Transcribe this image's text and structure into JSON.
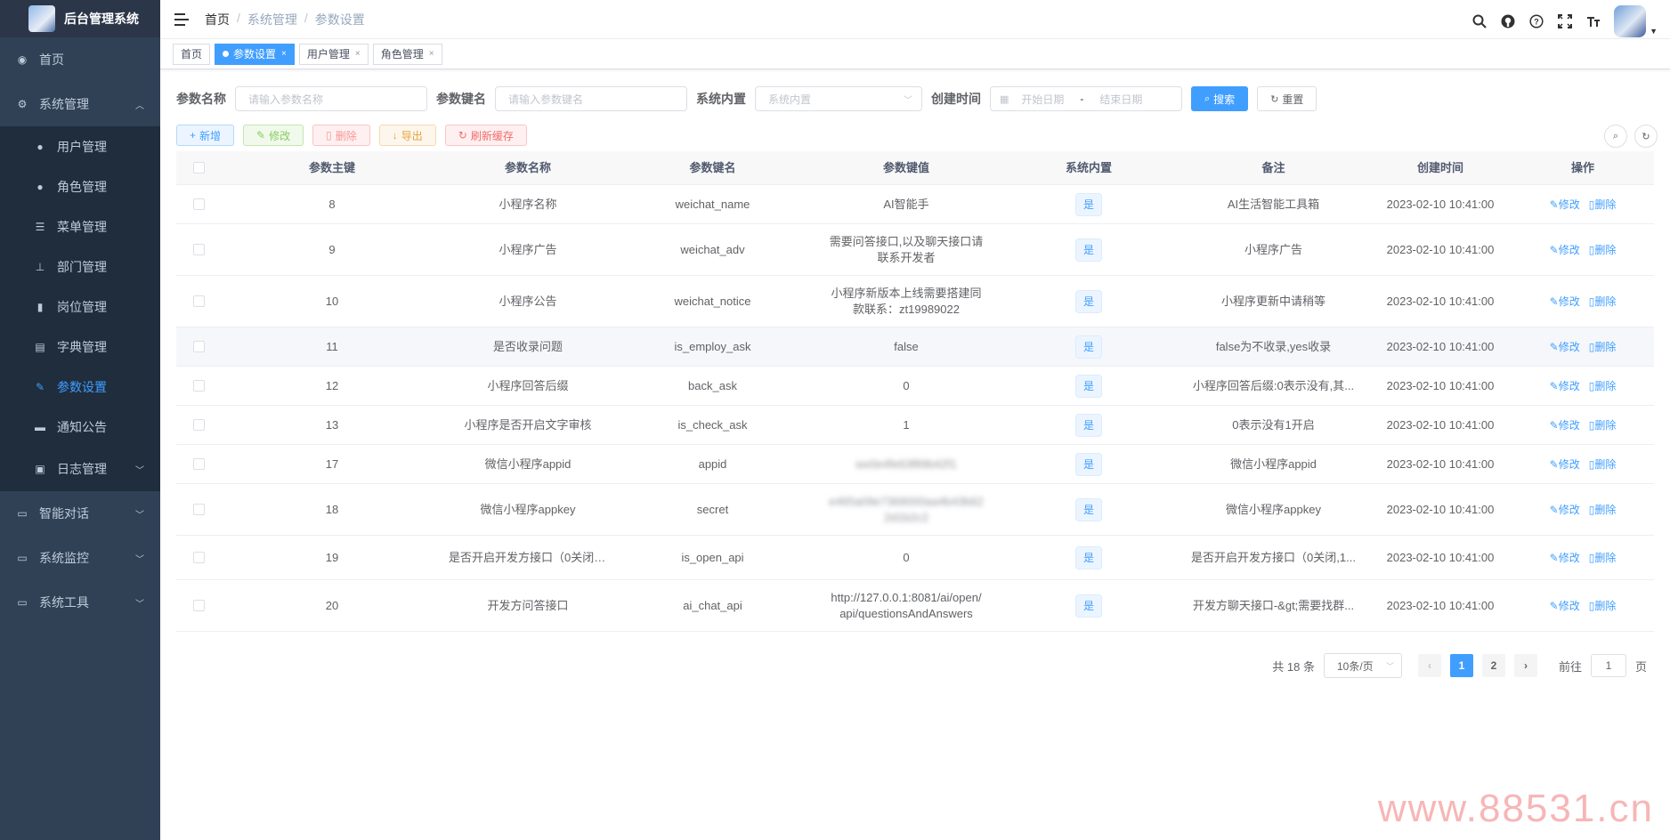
{
  "sidebar": {
    "title": "后台管理系统",
    "items": [
      {
        "label": "首页",
        "icon": "dashboard-icon"
      },
      {
        "label": "系统管理",
        "icon": "gear-icon",
        "expanded": true
      },
      {
        "label": "智能对话",
        "icon": "chat-icon"
      },
      {
        "label": "系统监控",
        "icon": "monitor-icon"
      },
      {
        "label": "系统工具",
        "icon": "toolbox-icon"
      }
    ],
    "sub_items": [
      {
        "label": "用户管理",
        "icon": "user-icon"
      },
      {
        "label": "角色管理",
        "icon": "people-icon"
      },
      {
        "label": "菜单管理",
        "icon": "tree-table-icon"
      },
      {
        "label": "部门管理",
        "icon": "org-tree-icon"
      },
      {
        "label": "岗位管理",
        "icon": "post-icon"
      },
      {
        "label": "字典管理",
        "icon": "dict-icon"
      },
      {
        "label": "参数设置",
        "icon": "edit-icon",
        "active": true
      },
      {
        "label": "通知公告",
        "icon": "message-icon"
      },
      {
        "label": "日志管理",
        "icon": "log-icon"
      }
    ]
  },
  "breadcrumb": [
    "首页",
    "系统管理",
    "参数设置"
  ],
  "tags": [
    {
      "label": "首页"
    },
    {
      "label": "参数设置",
      "active": true
    },
    {
      "label": "用户管理"
    },
    {
      "label": "角色管理"
    }
  ],
  "search": {
    "name_label": "参数名称",
    "name_placeholder": "请输入参数名称",
    "key_label": "参数键名",
    "key_placeholder": "请输入参数键名",
    "type_label": "系统内置",
    "type_placeholder": "系统内置",
    "time_label": "创建时间",
    "start_placeholder": "开始日期",
    "range_sep": "-",
    "end_placeholder": "结束日期",
    "search_btn": "搜索",
    "reset_btn": "重置"
  },
  "actions": {
    "add": "新增",
    "edit": "修改",
    "delete": "删除",
    "export": "导出",
    "refresh": "刷新缓存"
  },
  "table": {
    "headers": [
      "参数主键",
      "参数名称",
      "参数键名",
      "参数键值",
      "系统内置",
      "备注",
      "创建时间",
      "操作"
    ],
    "op_edit": "修改",
    "op_delete": "删除",
    "rows": [
      {
        "id": "8",
        "name": "小程序名称",
        "key": "weichat_name",
        "value": "AI智能手",
        "builtin": "是",
        "remark": "AI生活智能工具箱",
        "time": "2023-02-10 10:41:00"
      },
      {
        "id": "9",
        "name": "小程序广告",
        "key": "weichat_adv",
        "value": "需要问答接口,以及聊天接口请联系开发者",
        "builtin": "是",
        "remark": "小程序广告",
        "time": "2023-02-10 10:41:00"
      },
      {
        "id": "10",
        "name": "小程序公告",
        "key": "weichat_notice",
        "value": "小程序新版本上线需要搭建同款联系：zt19989022",
        "builtin": "是",
        "remark": "小程序更新中请稍等",
        "time": "2023-02-10 10:41:00"
      },
      {
        "id": "11",
        "name": "是否收录问题",
        "key": "is_employ_ask",
        "value": "false",
        "builtin": "是",
        "remark": "false为不收录,yes收录",
        "time": "2023-02-10 10:41:00"
      },
      {
        "id": "12",
        "name": "小程序回答后缀",
        "key": "back_ask",
        "value": "0",
        "builtin": "是",
        "remark": "小程序回答后缀:0表示没有,其...",
        "time": "2023-02-10 10:41:00"
      },
      {
        "id": "13",
        "name": "小程序是否开启文字审核",
        "key": "is_check_ask",
        "value": "1",
        "builtin": "是",
        "remark": "0表示没有1开启",
        "time": "2023-02-10 10:41:00"
      },
      {
        "id": "17",
        "name": "微信小程序appid",
        "key": "appid",
        "value": "wx0e4fe63f89b42f1",
        "builtin": "是",
        "remark": "微信小程序appid",
        "time": "2023-02-10 10:41:00",
        "blurred": true
      },
      {
        "id": "18",
        "name": "微信小程序appkey",
        "key": "secret",
        "value": "e465a09e7369000aa4b43b622d1b2c2",
        "builtin": "是",
        "remark": "微信小程序appkey",
        "time": "2023-02-10 10:41:00",
        "blurred": true
      },
      {
        "id": "19",
        "name": "是否开启开发方接口（0关闭,1...",
        "key": "is_open_api",
        "value": "0",
        "builtin": "是",
        "remark": "是否开启开发方接口（0关闭,1...",
        "time": "2023-02-10 10:41:00"
      },
      {
        "id": "20",
        "name": "开发方问答接口",
        "key": "ai_chat_api",
        "value": "http://127.0.0.1:8081/ai/open/api/questionsAndAnswers",
        "builtin": "是",
        "remark": "开发方聊天接口-&gt;需要找群...",
        "time": "2023-02-10 10:41:00"
      }
    ]
  },
  "pagination": {
    "total": "共 18 条",
    "page_size": "10条/页",
    "pages": [
      "1",
      "2"
    ],
    "goto_prefix": "前往",
    "goto_value": "1",
    "goto_suffix": "页"
  },
  "watermark": "www.88531.cn"
}
